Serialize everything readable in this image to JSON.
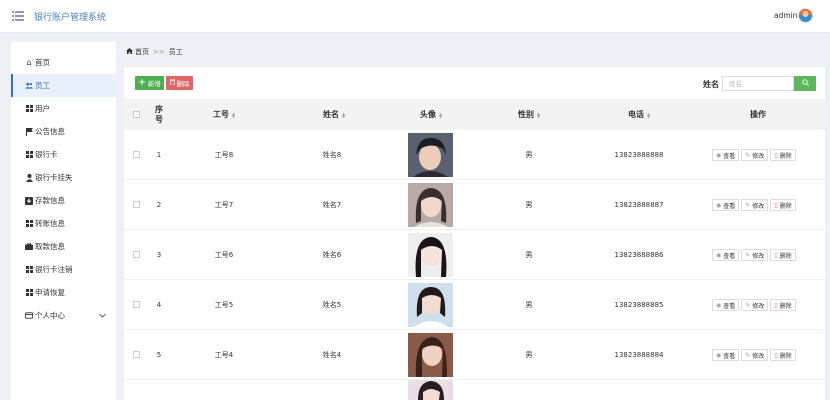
{
  "header": {
    "title": "银行账户管理系统",
    "user": "admin"
  },
  "sidebar": {
    "items": [
      {
        "label": "首页",
        "icon": "home-icon"
      },
      {
        "label": "员工",
        "icon": "users-icon"
      },
      {
        "label": "用户",
        "icon": "grid-icon"
      },
      {
        "label": "公告信息",
        "icon": "flag-icon"
      },
      {
        "label": "银行卡",
        "icon": "grid-icon"
      },
      {
        "label": "银行卡挂失",
        "icon": "user-icon"
      },
      {
        "label": "存款信息",
        "icon": "download-icon"
      },
      {
        "label": "转账信息",
        "icon": "grid-icon"
      },
      {
        "label": "取款信息",
        "icon": "briefcase-icon"
      },
      {
        "label": "银行卡注销",
        "icon": "grid-icon"
      },
      {
        "label": "申请恢复",
        "icon": "grid-icon"
      },
      {
        "label": "个人中心",
        "icon": "card-icon"
      }
    ]
  },
  "breadcrumb": {
    "home": "首页",
    "separator": ">>",
    "current": "员工"
  },
  "toolbar": {
    "add_label": "新增",
    "delete_label": "删除"
  },
  "search": {
    "label": "姓名",
    "placeholder": "姓名"
  },
  "table": {
    "columns": [
      "序号",
      "工号",
      "姓名",
      "头像",
      "性别",
      "电话",
      "操作"
    ],
    "actions": {
      "view": "查看",
      "edit": "修改",
      "delete": "删除"
    },
    "rows": [
      {
        "index": "1",
        "id": "工号8",
        "name": "姓名8",
        "gender": "男",
        "phone": "13823888888"
      },
      {
        "index": "2",
        "id": "工号7",
        "name": "姓名7",
        "gender": "男",
        "phone": "13823888887"
      },
      {
        "index": "3",
        "id": "工号6",
        "name": "姓名6",
        "gender": "男",
        "phone": "13823888886"
      },
      {
        "index": "4",
        "id": "工号5",
        "name": "姓名5",
        "gender": "男",
        "phone": "13823888885"
      },
      {
        "index": "5",
        "id": "工号4",
        "name": "姓名4",
        "gender": "男",
        "phone": "13823888884"
      }
    ]
  },
  "colors": {
    "accent": "#3a6fc0",
    "add": "#4caf50",
    "delete": "#e06666",
    "search": "#5cb85c"
  }
}
